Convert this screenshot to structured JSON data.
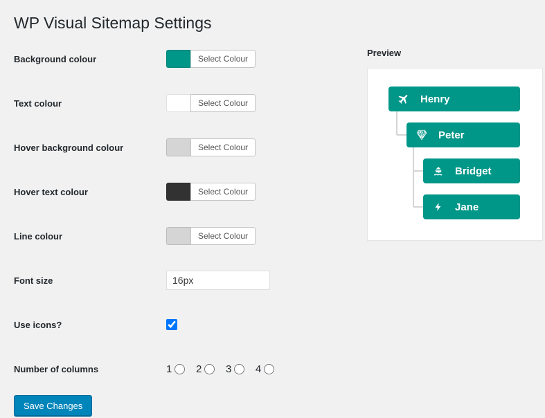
{
  "page_title": "WP Visual Sitemap Settings",
  "rows": {
    "bg": {
      "label": "Background colour",
      "btn": "Select Colour",
      "swatch": "#009688"
    },
    "text": {
      "label": "Text colour",
      "btn": "Select Colour",
      "swatch": "#ffffff"
    },
    "hbg": {
      "label": "Hover background colour",
      "btn": "Select Colour",
      "swatch": "#d5d5d5"
    },
    "htext": {
      "label": "Hover text colour",
      "btn": "Select Colour",
      "swatch": "#323232"
    },
    "line": {
      "label": "Line colour",
      "btn": "Select Colour",
      "swatch": "#d5d5d5"
    },
    "font": {
      "label": "Font size",
      "value": "16px"
    },
    "icons": {
      "label": "Use icons?"
    },
    "cols": {
      "label": "Number of columns",
      "options": [
        "1",
        "2",
        "3",
        "4"
      ]
    }
  },
  "save_label": "Save Changes",
  "preview": {
    "title": "Preview",
    "line_color": "#d5d5d5",
    "nodes": {
      "n1": "Henry",
      "n2": "Peter",
      "n3": "Bridget",
      "n4": "Jane"
    }
  }
}
